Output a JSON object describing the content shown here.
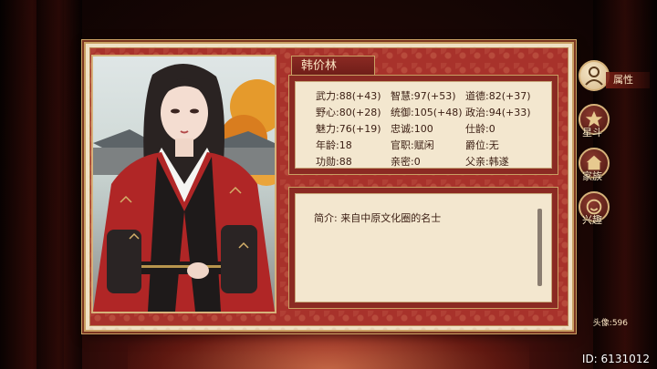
{
  "character": {
    "name": "韩价林",
    "avatar_label": "头像:596"
  },
  "stats": [
    {
      "label": "武力:88(+43)"
    },
    {
      "label": "智慧:97(+53)"
    },
    {
      "label": "道德:82(+37)"
    },
    {
      "label": "野心:80(+28)"
    },
    {
      "label": "统御:105(+48)"
    },
    {
      "label": "政治:94(+33)"
    },
    {
      "label": "魅力:76(+19)"
    },
    {
      "label": "忠诚:100"
    },
    {
      "label": "仕龄:0"
    },
    {
      "label": "年龄:18"
    },
    {
      "label": "官职:赋闲"
    },
    {
      "label": "爵位:无"
    },
    {
      "label": "功勋:88"
    },
    {
      "label": "亲密:0"
    },
    {
      "label": "父亲:韩遂"
    }
  ],
  "intro": "简介: 来自中原文化圈的名士",
  "side_menu": {
    "items": [
      {
        "label": "属性",
        "icon": "person-icon"
      },
      {
        "label": "星斗",
        "icon": "star-icon"
      },
      {
        "label": "家族",
        "icon": "family-icon"
      },
      {
        "label": "兴趣",
        "icon": "interest-icon"
      }
    ]
  },
  "footer": {
    "game_id": "ID: 6131012"
  },
  "colors": {
    "panel_red": "#8b2a23",
    "panel_cream": "#f3e7cf",
    "gold_border": "#c9a063",
    "text_dark": "#3a1d12"
  }
}
